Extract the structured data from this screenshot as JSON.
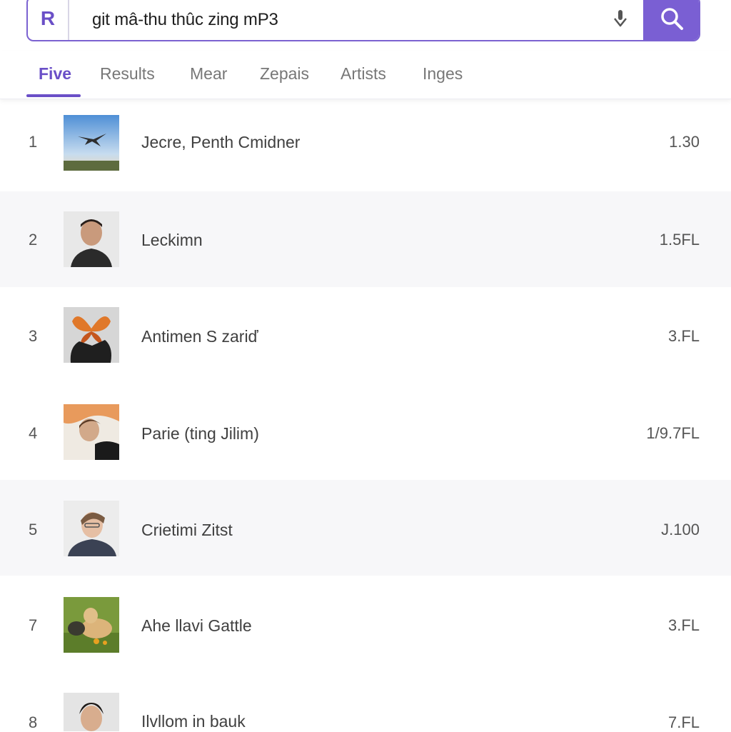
{
  "search": {
    "query": "git mâ-thu thûc zing mP3",
    "logo": "R"
  },
  "icons": {
    "logo": "logo-icon",
    "mic": "mic-icon",
    "search": "search-icon"
  },
  "colors": {
    "accent": "#7a5fd3",
    "tab_active": "#6a4fc7"
  },
  "tabs": [
    {
      "label": "Five",
      "active": true
    },
    {
      "label": "Results",
      "active": false
    },
    {
      "label": "Mear",
      "active": false
    },
    {
      "label": "Zepais",
      "active": false
    },
    {
      "label": "Artists",
      "active": false
    },
    {
      "label": "Inges",
      "active": false
    }
  ],
  "results": [
    {
      "num": "1",
      "title": "Jecre, Penth Cmidner",
      "meta": "1.30"
    },
    {
      "num": "2",
      "title": "Leckimn",
      "meta": "1.5FL"
    },
    {
      "num": "3",
      "title": "Antimen S zariď",
      "meta": "3.FL"
    },
    {
      "num": "4",
      "title": "Parie (ting Jilim)",
      "meta": "1/9.7FL"
    },
    {
      "num": "5",
      "title": "Crietimi Zitst",
      "meta": "J.100"
    },
    {
      "num": "7",
      "title": "Ahe llavi Gattle",
      "meta": "3.FL"
    },
    {
      "num": "8",
      "title": "Ilvllom in bauk",
      "meta": "7.FL"
    }
  ]
}
